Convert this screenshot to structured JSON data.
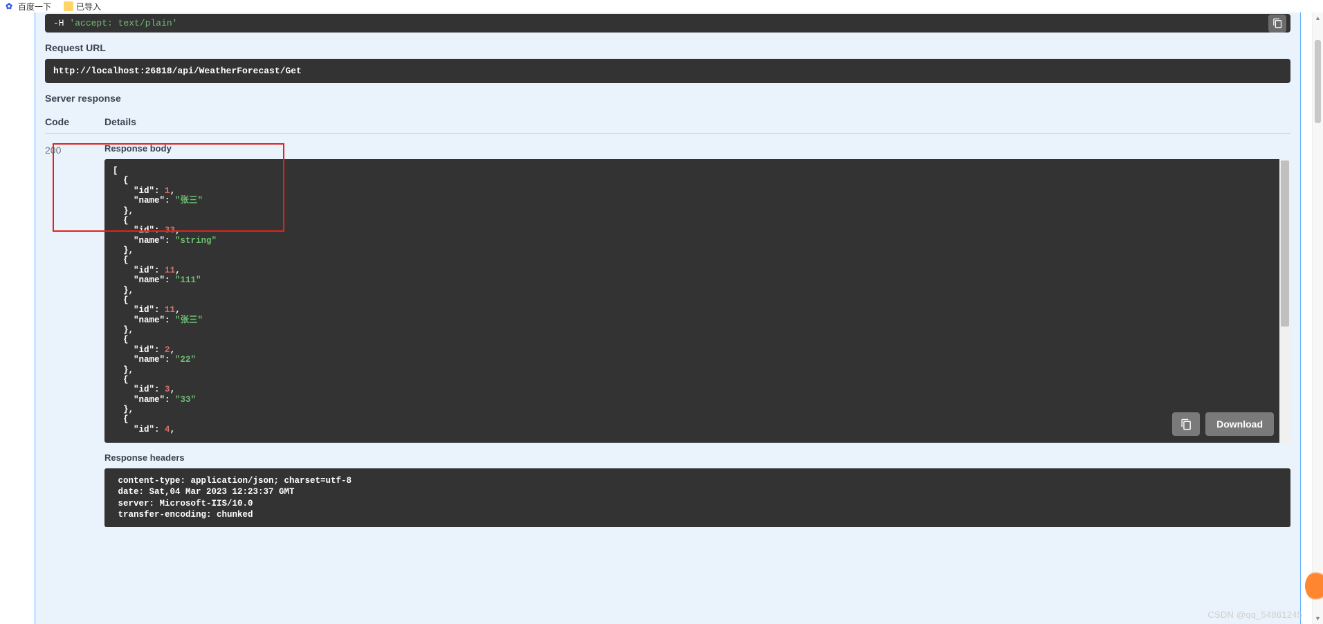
{
  "bookmarks": {
    "baidu": "百度一下",
    "imported": "已导入"
  },
  "curl": {
    "flag": "-H",
    "value": "'accept: text/plain'"
  },
  "sections": {
    "request_url": "Request URL",
    "server_response": "Server response",
    "response_body": "Response body",
    "response_headers": "Response headers"
  },
  "request_url": "http://localhost:26818/api/WeatherForecast/Get",
  "columns": {
    "code": "Code",
    "details": "Details"
  },
  "status_code": "200",
  "response_body": [
    {
      "id": 1,
      "name": "张三"
    },
    {
      "id": 33,
      "name": "string"
    },
    {
      "id": 11,
      "name": "111"
    },
    {
      "id": 11,
      "name": "张三"
    },
    {
      "id": 2,
      "name": "22"
    },
    {
      "id": 3,
      "name": "33"
    },
    {
      "id": 4
    }
  ],
  "response_headers": {
    "content-type": "application/json; charset=utf-8",
    "date": "Sat,04 Mar 2023 12:23:37 GMT",
    "server": "Microsoft-IIS/10.0",
    "transfer-encoding": "chunked"
  },
  "buttons": {
    "download": "Download"
  },
  "watermark": "CSDN @qq_54861245"
}
